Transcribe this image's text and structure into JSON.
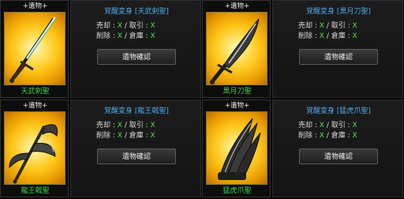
{
  "cards": [
    {
      "relic_tag": "+遺物+",
      "item_name": "天武剣聖",
      "title": "覚醒変身 [天武剣聖]",
      "sell_label": "売却",
      "sell_value": "X",
      "trade_label": "取引",
      "trade_value": "X",
      "delete_label": "削除",
      "delete_value": "X",
      "storage_label": "倉庫",
      "storage_value": "X",
      "confirm_label": "遺物確認",
      "icon": "straight-sword-icon"
    },
    {
      "relic_tag": "+遺物+",
      "item_name": "黒月刀聖",
      "title": "覚醒変身 [黒月刀聖]",
      "sell_label": "売却",
      "sell_value": "X",
      "trade_label": "取引",
      "trade_value": "X",
      "delete_label": "削除",
      "delete_value": "X",
      "storage_label": "倉庫",
      "storage_value": "X",
      "confirm_label": "遺物確認",
      "icon": "curved-blade-icon"
    },
    {
      "relic_tag": "+遺物+",
      "item_name": "龍王戟聖",
      "title": "覚醒変身 [龍王戟聖]",
      "sell_label": "売却",
      "sell_value": "X",
      "trade_label": "取引",
      "trade_value": "X",
      "delete_label": "削除",
      "delete_value": "X",
      "storage_label": "倉庫",
      "storage_value": "X",
      "confirm_label": "遺物確認",
      "icon": "halberd-icon"
    },
    {
      "relic_tag": "+遺物+",
      "item_name": "猛虎爪聖",
      "title": "覚醒変身 [猛虎爪聖]",
      "sell_label": "売却",
      "sell_value": "X",
      "trade_label": "取引",
      "trade_value": "X",
      "delete_label": "削除",
      "delete_value": "X",
      "storage_label": "倉庫",
      "storage_value": "X",
      "confirm_label": "遺物確認",
      "icon": "claw-icon"
    }
  ]
}
